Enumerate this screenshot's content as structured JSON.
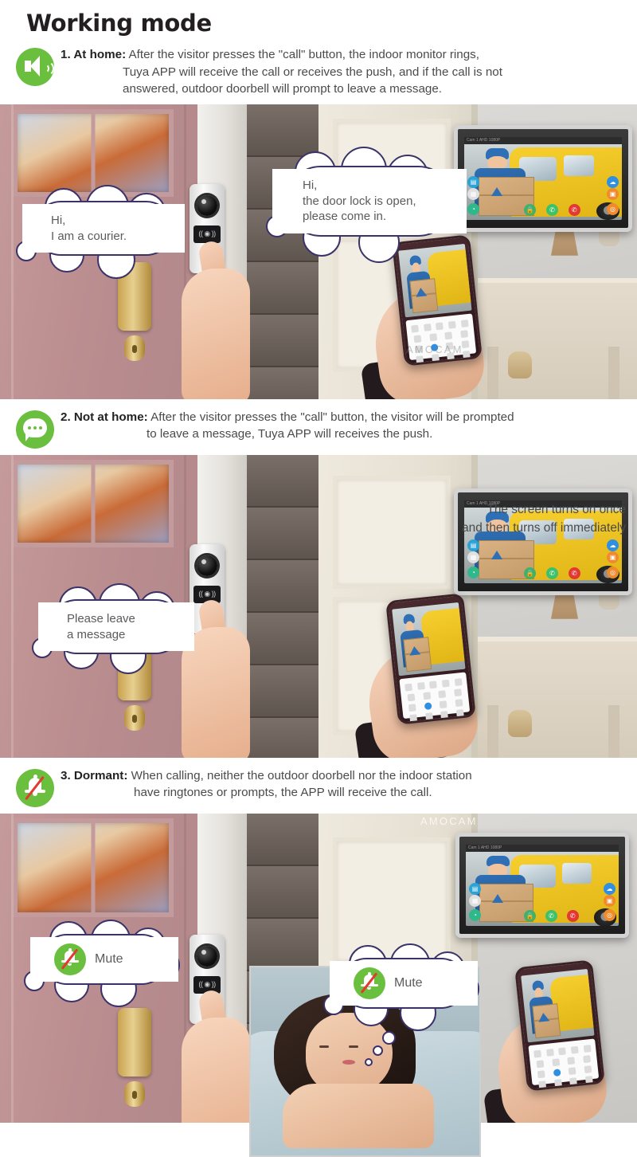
{
  "heading": "Working mode",
  "brand_watermark": "AMOCAM",
  "modes": [
    {
      "number_label": "1. At home:",
      "line1": "After the visitor presses the \"call\" button, the indoor monitor rings,",
      "line2": "Tuya APP will receive the call or receives the push, and if the call is not",
      "line3": "answered, outdoor doorbell will prompt to leave a message.",
      "icon": "speaker-sound-icon",
      "icon_color": "#6abf3e"
    },
    {
      "number_label": "2. Not at home:",
      "line1": "After the visitor presses the \"call\" button,  the visitor will be prompted",
      "line2": "to leave a message, Tuya APP will receives the push.",
      "line3": "",
      "icon": "chat-bubble-icon",
      "icon_color": "#6abf3e"
    },
    {
      "number_label": "3. Dormant:",
      "line1": "When calling, neither the outdoor doorbell nor the indoor station",
      "line2": "have ringtones or prompts, the APP will receive the call.",
      "line3": "",
      "icon": "bell-mute-icon",
      "icon_color": "#6abf3e"
    }
  ],
  "panel1": {
    "bubble_visitor": "Hi,\nI am a courier.",
    "bubble_host": "Hi,\nthe door lock is open,\nplease come in.",
    "monitor_status": "Cam 1        AHD 1080P"
  },
  "panel2": {
    "bubble_visitor": "Please leave\na message",
    "caption_line1": "The screen turns on once",
    "caption_line2": "and then turns off immediately",
    "monitor_status": "Cam 1        AHD 1080P"
  },
  "panel3": {
    "mute_label_outdoor": "Mute",
    "mute_label_indoor": "Mute",
    "monitor_status": "Cam 1        AHD 1080P"
  },
  "colors": {
    "accent_green": "#6abf3e",
    "bubble_outline": "#3b3268",
    "slash_red": "#e23a2e",
    "answer_green": "#3fc16a",
    "hangup_red": "#e23a33",
    "text_gray": "#5b5b5b",
    "heading_black": "#231f20"
  }
}
